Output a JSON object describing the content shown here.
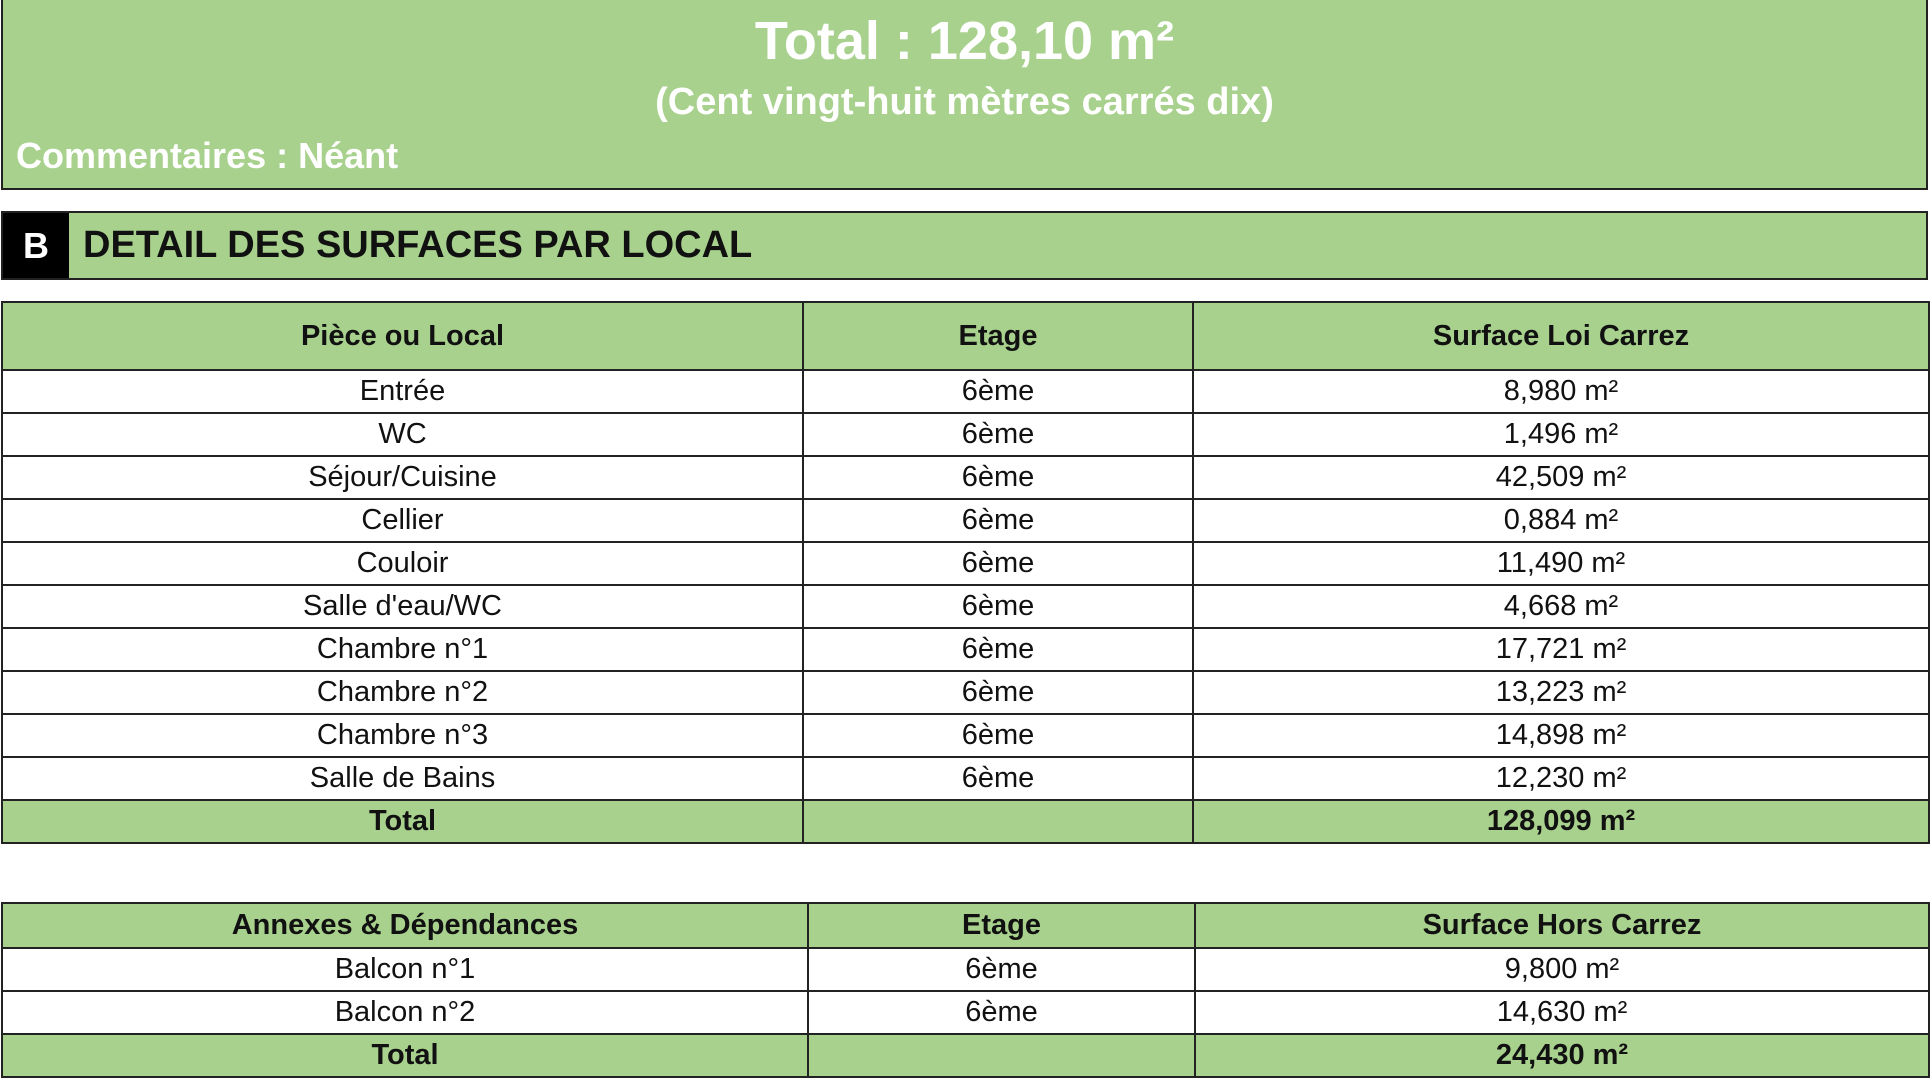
{
  "summary": {
    "total": "Total : 128,10 m²",
    "total_words": "(Cent vingt-huit mètres carrés dix)",
    "comment": "Commentaires : Néant"
  },
  "section": {
    "letter": "B",
    "title": "DETAIL DES SURFACES PAR LOCAL"
  },
  "table_loi_carrez": {
    "headers": [
      "Pièce ou Local",
      "Etage",
      "Surface Loi Carrez"
    ],
    "rows": [
      [
        "Entrée",
        "6ème",
        "8,980 m²"
      ],
      [
        "WC",
        "6ème",
        "1,496 m²"
      ],
      [
        "Séjour/Cuisine",
        "6ème",
        "42,509 m²"
      ],
      [
        "Cellier",
        "6ème",
        "0,884 m²"
      ],
      [
        "Couloir",
        "6ème",
        "11,490 m²"
      ],
      [
        "Salle d'eau/WC",
        "6ème",
        "4,668 m²"
      ],
      [
        "Chambre n°1",
        "6ème",
        "17,721 m²"
      ],
      [
        "Chambre n°2",
        "6ème",
        "13,223 m²"
      ],
      [
        "Chambre n°3",
        "6ème",
        "14,898 m²"
      ],
      [
        "Salle de Bains",
        "6ème",
        "12,230 m²"
      ]
    ],
    "total_label": "Total",
    "total_floor": "",
    "total_value": "128,099 m²"
  },
  "table_annexes": {
    "headers": [
      "Annexes & Dépendances",
      "Etage",
      "Surface Hors Carrez"
    ],
    "rows": [
      [
        "Balcon n°1",
        "6ème",
        "9,800 m²"
      ],
      [
        "Balcon n°2",
        "6ème",
        "14,630 m²"
      ]
    ],
    "total_label": "Total",
    "total_floor": "",
    "total_value": "24,430 m²"
  },
  "colors": {
    "accent_green": "#a8d18d",
    "border": "#222222",
    "banner_text": "#ffffff"
  }
}
